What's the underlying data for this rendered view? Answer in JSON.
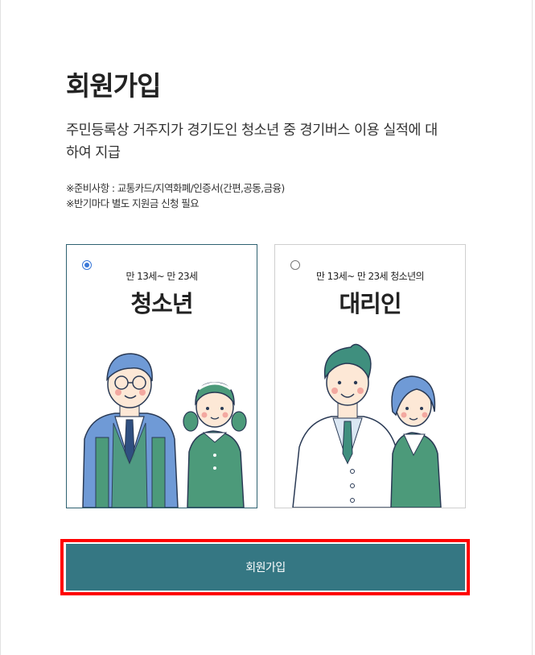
{
  "page": {
    "title": "회원가입",
    "description": "주민등록상 거주지가 경기도인 청소년 중 경기버스 이용 실적에 대하여 지급",
    "notes": [
      "※준비사항 : 교통카드/지역화폐/인증서(간편,공동,금융)",
      "※반기마다 별도 지원금 신청 필요"
    ]
  },
  "options": [
    {
      "subtitle": "만 13세~ 만 23세",
      "title": "청소년",
      "selected": true
    },
    {
      "subtitle": "만 13세~ 만 23세 청소년의",
      "title": "대리인",
      "selected": false
    }
  ],
  "submit": {
    "label": "회원가입"
  },
  "colors": {
    "accent": "#357783",
    "selected_border": "#2f6271",
    "highlight": "#ff0000",
    "radio": "#3a78d8",
    "illustration_blue": "#6f9ad6",
    "illustration_green": "#4c9a7a",
    "illustration_teal": "#3f8f7e"
  }
}
